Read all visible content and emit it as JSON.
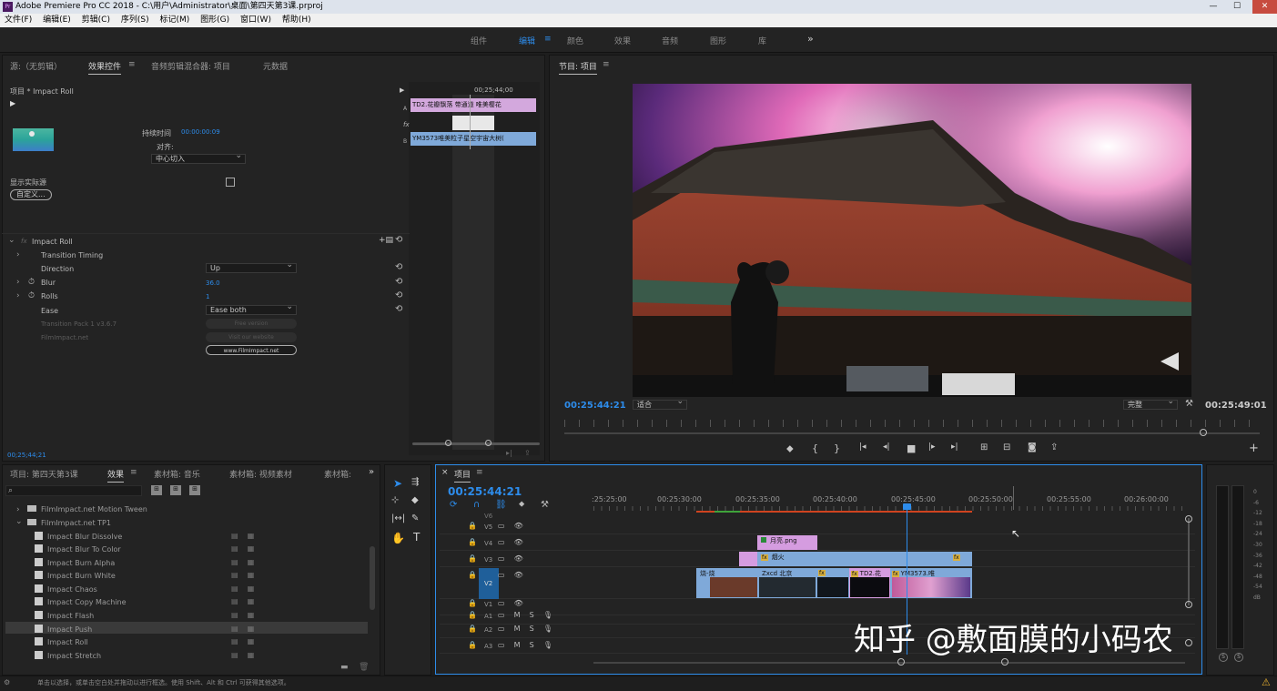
{
  "titlebar": {
    "title": "Adobe Premiere Pro CC 2018 - C:\\用户\\Administrator\\桌面\\第四天第3课.prproj",
    "min": "—",
    "max": "☐",
    "close": "✕"
  },
  "menu": [
    "文件(F)",
    "编辑(E)",
    "剪辑(C)",
    "序列(S)",
    "标记(M)",
    "图形(G)",
    "窗口(W)",
    "帮助(H)"
  ],
  "workspaces": [
    "组件",
    "编辑",
    "颜色",
    "效果",
    "音频",
    "图形",
    "库"
  ],
  "workspace_more": "»",
  "source_panel": {
    "tabs": [
      "源:（无剪辑）",
      "效果控件",
      "音频剪辑混合器: 项目",
      "元数据"
    ],
    "menu_glyph": "≡",
    "breadcrumb": "项目 * Impact Roll",
    "timecode_ruler": "00;25;44;00",
    "duration_label": "持续时间",
    "duration_value": "00:00:00:09",
    "align_label": "对齐:",
    "align_value": "中心切入",
    "clip_a": "TD2.花瓣飘落 带通道 唯美樱花",
    "clip_b": "YM3573唯美粒子星空宇宙大树(",
    "track_a": "A",
    "track_b": "B",
    "fx_badge": "fx",
    "show_actual": "显示实际源",
    "custom_button": "自定义...",
    "effect_name": "Impact Roll",
    "timing": "Transition Timing",
    "direction_label": "Direction",
    "direction_value": "Up",
    "blur_label": "Blur",
    "blur_value": "36.0",
    "rolls_label": "Rolls",
    "rolls_value": "1",
    "ease_label": "Ease",
    "ease_value": "Ease both",
    "pack_label": "Transition Pack 1 v3.6.7",
    "pack_btn": "Free version",
    "site_label": "FilmImpact.net",
    "site_btn": "Visit our website",
    "site_url_btn": "www.FilmImpact.net",
    "bottom_time": "00;25;44;21",
    "reset_glyph": "⟲",
    "expand_glyph": "›",
    "collapse_glyph": "⌄"
  },
  "program_panel": {
    "title": "节目: 项目",
    "current_time": "00:25:44:21",
    "fit": "适合",
    "quality": "完整",
    "end_time": "00:25:49:01",
    "add_glyph": "+",
    "wrench_glyph": "🔧",
    "controls": [
      "♥",
      "{",
      "}",
      "|←",
      "◂|",
      "■",
      "|▸",
      "→|",
      "⊞",
      "⊟",
      "⊡",
      "⇪"
    ]
  },
  "project_panel": {
    "tabs": [
      "项目: 第四天第3课",
      "效果",
      "素材箱: 音乐",
      "素材箱: 视频素材",
      "素材箱:"
    ],
    "more": "»",
    "search_glyph": "⌕",
    "folders": [
      "FilmImpact.net Motion Tween",
      "FilmImpact.net TP1"
    ],
    "items": [
      "Impact Blur Dissolve",
      "Impact Blur To Color",
      "Impact Burn Alpha",
      "Impact Burn White",
      "Impact Chaos",
      "Impact Copy Machine",
      "Impact Flash",
      "Impact Push",
      "Impact Roll",
      "Impact Stretch"
    ]
  },
  "timeline": {
    "title": "项目",
    "timecode": "00:25:44:21",
    "ticks": [
      ":25:25:00",
      "00:25:30:00",
      "00:25:35:00",
      "00:25:40:00",
      "00:25:45:00",
      "00:25:50:00",
      "00:25:55:00",
      "00:26:00:00"
    ],
    "tracks": [
      "V5",
      "V4",
      "V3",
      "V2",
      "V1",
      "A1",
      "A2",
      "A3"
    ],
    "v2_source": "V2",
    "v6_partial": "V6",
    "clips": {
      "v4": "月亮.png",
      "v3": "烟火",
      "v2a": "烧-烧",
      "v2b": "Zxcd 北京",
      "v2c": "TD2.花",
      "v2d": "YM3573.唯"
    },
    "mute": "M",
    "solo": "S"
  },
  "meter": {
    "scale": [
      "0",
      "-6",
      "-12",
      "-18",
      "-24",
      "-30",
      "-36",
      "-42",
      "-48",
      "-54",
      "dB"
    ],
    "solo": [
      "S",
      "S"
    ]
  },
  "status": "单击以选择，或单击空白处并拖动以进行框选。使用 Shift、Alt 和 Ctrl 可获得其他选项。",
  "watermark": "知乎 @敷面膜的小码农",
  "colors": {
    "accent": "#2d8ceb",
    "clip_purple": "#d59ce0",
    "clip_blue": "#7fa9d9",
    "playhead": "#2d8ceb"
  }
}
